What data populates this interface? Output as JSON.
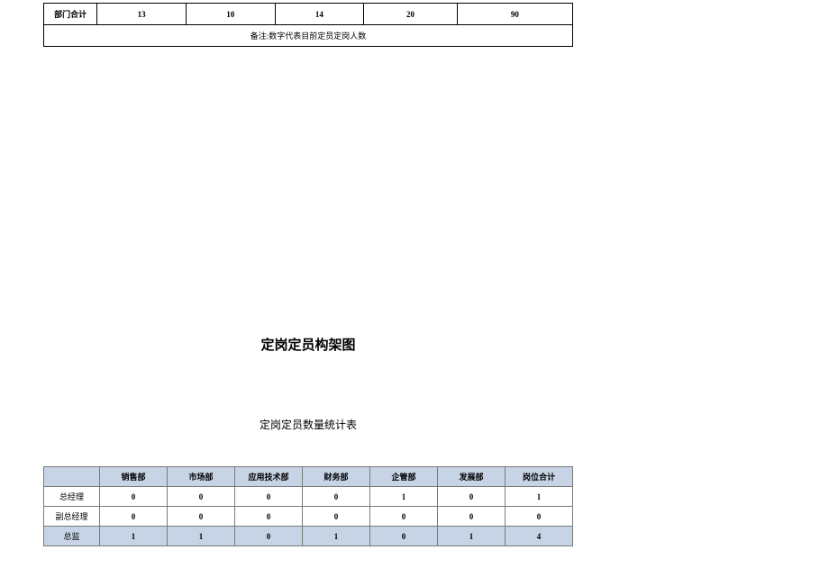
{
  "top_table": {
    "row_label": "部门合计",
    "values": [
      "13",
      "10",
      "14",
      "20",
      "90"
    ],
    "note": "备注:数字代表目前定员定岗人数"
  },
  "titles": {
    "main": "定岗定员构架图",
    "sub": "定岗定员数量统计表"
  },
  "bottom_table": {
    "headers": [
      "",
      "销售部",
      "市场部",
      "应用技术部",
      "财务部",
      "企管部",
      "发展部",
      "岗位合计"
    ],
    "rows": [
      {
        "label": "总经理",
        "values": [
          "0",
          "0",
          "0",
          "0",
          "1",
          "0",
          "1"
        ],
        "shaded": false
      },
      {
        "label": "副总经理",
        "values": [
          "0",
          "0",
          "0",
          "0",
          "0",
          "0",
          "0"
        ],
        "shaded": false
      },
      {
        "label": "总监",
        "values": [
          "1",
          "1",
          "0",
          "1",
          "0",
          "1",
          "4"
        ],
        "shaded": true
      }
    ]
  }
}
